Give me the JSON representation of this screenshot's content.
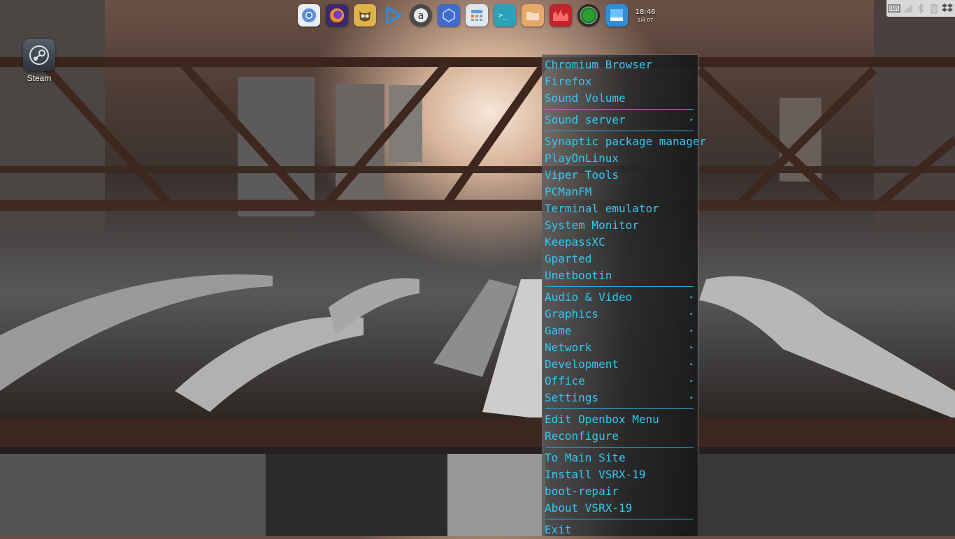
{
  "desktop": {
    "icons": [
      {
        "label": "Steam",
        "icon": "steam-icon"
      }
    ]
  },
  "dock": {
    "apps": [
      {
        "name": "chromium-icon",
        "bg": "#e9eef5"
      },
      {
        "name": "firefox-icon",
        "bg": "#3b2a6b"
      },
      {
        "name": "owl-icon",
        "bg": "#e0b24a"
      },
      {
        "name": "play-icon",
        "bg": "#f2f2f2"
      },
      {
        "name": "amazon-icon",
        "bg": "#4a4a4a"
      },
      {
        "name": "network-icon",
        "bg": "#3f6bc9"
      },
      {
        "name": "calculator-icon",
        "bg": "#dfe7ef"
      },
      {
        "name": "terminal-icon",
        "bg": "#2aa3b8"
      },
      {
        "name": "files-icon",
        "bg": "#e6a96a"
      },
      {
        "name": "system-monitor-icon",
        "bg": "#c0232b"
      },
      {
        "name": "green-circle-icon",
        "bg": "#2c2c2c"
      },
      {
        "name": "window-icon",
        "bg": "#2e8fd8"
      }
    ]
  },
  "clock": {
    "time": "18:46",
    "date": "1月 07"
  },
  "tray": {
    "icons": [
      "keyboard-icon",
      "signal-icon",
      "bluetooth-icon",
      "battery-icon",
      "dropbox-icon"
    ]
  },
  "menu": {
    "accent": "#35c8f5",
    "items": [
      {
        "label": "Chromium Browser"
      },
      {
        "label": "Firefox"
      },
      {
        "label": "Sound Volume"
      },
      {
        "sep": true
      },
      {
        "label": "Sound server",
        "submenu": true
      },
      {
        "sep": true
      },
      {
        "label": "Synaptic package manager"
      },
      {
        "label": "PlayOnLinux"
      },
      {
        "label": "Viper Tools"
      },
      {
        "label": "PCManFM"
      },
      {
        "label": "Terminal emulator"
      },
      {
        "label": "System Monitor"
      },
      {
        "label": "KeepassXC"
      },
      {
        "label": "Gparted"
      },
      {
        "label": "Unetbootin"
      },
      {
        "sep": true
      },
      {
        "label": "Audio & Video",
        "submenu": true
      },
      {
        "label": "Graphics",
        "submenu": true
      },
      {
        "label": "Game",
        "submenu": true
      },
      {
        "label": "Network",
        "submenu": true
      },
      {
        "label": "Development",
        "submenu": true
      },
      {
        "label": "Office",
        "submenu": true
      },
      {
        "label": "Settings",
        "submenu": true
      },
      {
        "sep": true
      },
      {
        "label": "Edit Openbox Menu"
      },
      {
        "label": "Reconfigure"
      },
      {
        "sep": true
      },
      {
        "label": "To Main Site"
      },
      {
        "label": "Install VSRX-19"
      },
      {
        "label": "boot-repair"
      },
      {
        "label": "About VSRX-19"
      },
      {
        "sep": true
      },
      {
        "label": "Exit"
      }
    ]
  }
}
